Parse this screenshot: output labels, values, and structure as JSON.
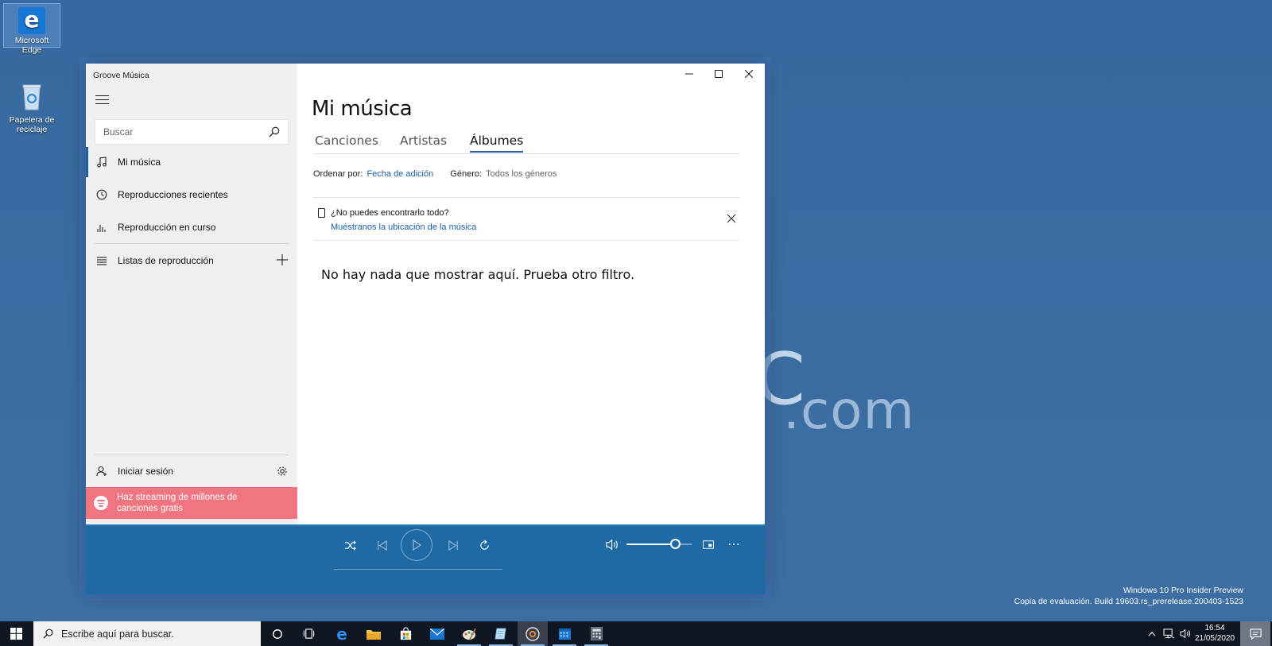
{
  "desktop": {
    "icons": [
      {
        "label": "Microsoft Edge",
        "icon": "edge-icon"
      },
      {
        "label": "Papelera de reciclaje",
        "icon": "recycle-bin-icon"
      }
    ],
    "watermark_c": "C",
    "watermark_com": ".com",
    "windows_info_line1": "Windows 10 Pro Insider Preview",
    "windows_info_line2": "Copia de evaluación. Build 19603.rs_prerelease.200403-1523"
  },
  "app": {
    "title": "Groove Música",
    "accent_color": "#1d5fa8",
    "player_color": "#1f6aa5",
    "sidebar": {
      "search_placeholder": "Buscar",
      "nav": [
        {
          "label": "Mi música",
          "icon": "music-note-icon",
          "active": true
        },
        {
          "label": "Reproducciones recientes",
          "icon": "clock-icon"
        },
        {
          "label": "Reproducción en curso",
          "icon": "equalizer-icon"
        },
        {
          "label": "Listas de reproducción",
          "icon": "playlist-icon"
        }
      ],
      "sign_in": "Iniciar sesión",
      "spotify_banner": "Haz streaming de millones de canciones gratis",
      "spotify_color": "#f17580"
    },
    "main": {
      "page_title": "Mi música",
      "tabs": [
        "Canciones",
        "Artistas",
        "Álbumes"
      ],
      "active_tab": "Álbumes",
      "sort_label": "Ordenar por:",
      "sort_value": "Fecha de adición",
      "genre_label": "Género:",
      "genre_value": "Todos los géneros",
      "notice_question": "¿No puedes encontrarlo todo?",
      "notice_link": "Muéstranos la ubicación de la música",
      "empty_message": "No hay nada que mostrar aquí. Prueba otro filtro."
    }
  },
  "taskbar": {
    "search_placeholder": "Escribe aquí para buscar.",
    "time": "16:54",
    "date": "21/05/2020"
  }
}
